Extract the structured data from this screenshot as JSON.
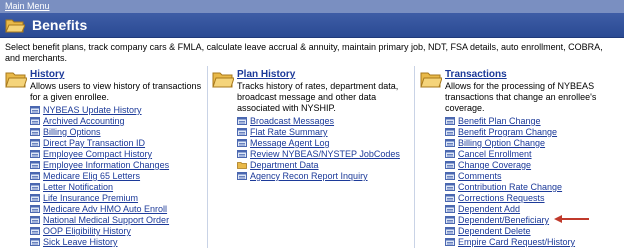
{
  "topbar": {
    "main_menu_link": "Main Menu"
  },
  "header": {
    "title": "Benefits",
    "folder_icon": "folder-open-icon"
  },
  "description": "Select benefit plans, track company cars & FMLA, calculate leave accrual & annuity, maintain primary job, NDT, FSA details, auto enrollment, COBRA, and merchants.",
  "history": {
    "title": "History",
    "description": "Allows users to view history of transactions for a given enrollee.",
    "icon": "folder-icon",
    "links": [
      "NYBEAS Update History",
      "Archived Accounting",
      "Billing Options",
      "Direct Pay Transaction ID",
      "Employee Compact History",
      "Employee Information Changes",
      "Medicare Elig 65 Letters",
      "Letter Notification",
      "Life Insurance Premium",
      "Medicare Adv HMO Auto Enroll",
      "National Medical Support Order",
      "OOP Eligibility History",
      "Sick Leave History"
    ]
  },
  "plan_history": {
    "title": "Plan History",
    "description": "Tracks history of rates, department data, broadcast message and other data associated with NYSHIP.",
    "icon": "folder-icon",
    "links": [
      {
        "label": "Broadcast Messages",
        "icon": "component-icon"
      },
      {
        "label": "Flat Rate Summary",
        "icon": "component-icon"
      },
      {
        "label": "Message Agent Log",
        "icon": "component-icon"
      },
      {
        "label": "Review NYBEAS/NYSTEP JobCodes",
        "icon": "component-icon"
      },
      {
        "label": "Department Data",
        "icon": "folder-small-icon"
      },
      {
        "label": "Agency Recon Report Inquiry",
        "icon": "component-icon"
      }
    ]
  },
  "transactions": {
    "title": "Transactions",
    "description": "Allows for the processing of NYBEAS transactions that change an enrollee's coverage.",
    "icon": "folder-icon",
    "links": [
      "Benefit Plan Change",
      "Benefit Program Change",
      "Billing Option Change",
      "Cancel Enrollment",
      "Change Coverage",
      "Comments",
      "Contribution Rate Change",
      "Corrections Requests",
      "Dependent Add",
      "Dependent/Beneficiary",
      "Dependent Delete",
      "Empire Card Request/History"
    ],
    "highlight_arrow_target": "Dependent/Beneficiary"
  },
  "colors": {
    "link": "#1c3a99",
    "header_bg": "#2f4f9c",
    "topbar_bg": "#7a8fc1",
    "arrow": "#c0392b"
  }
}
